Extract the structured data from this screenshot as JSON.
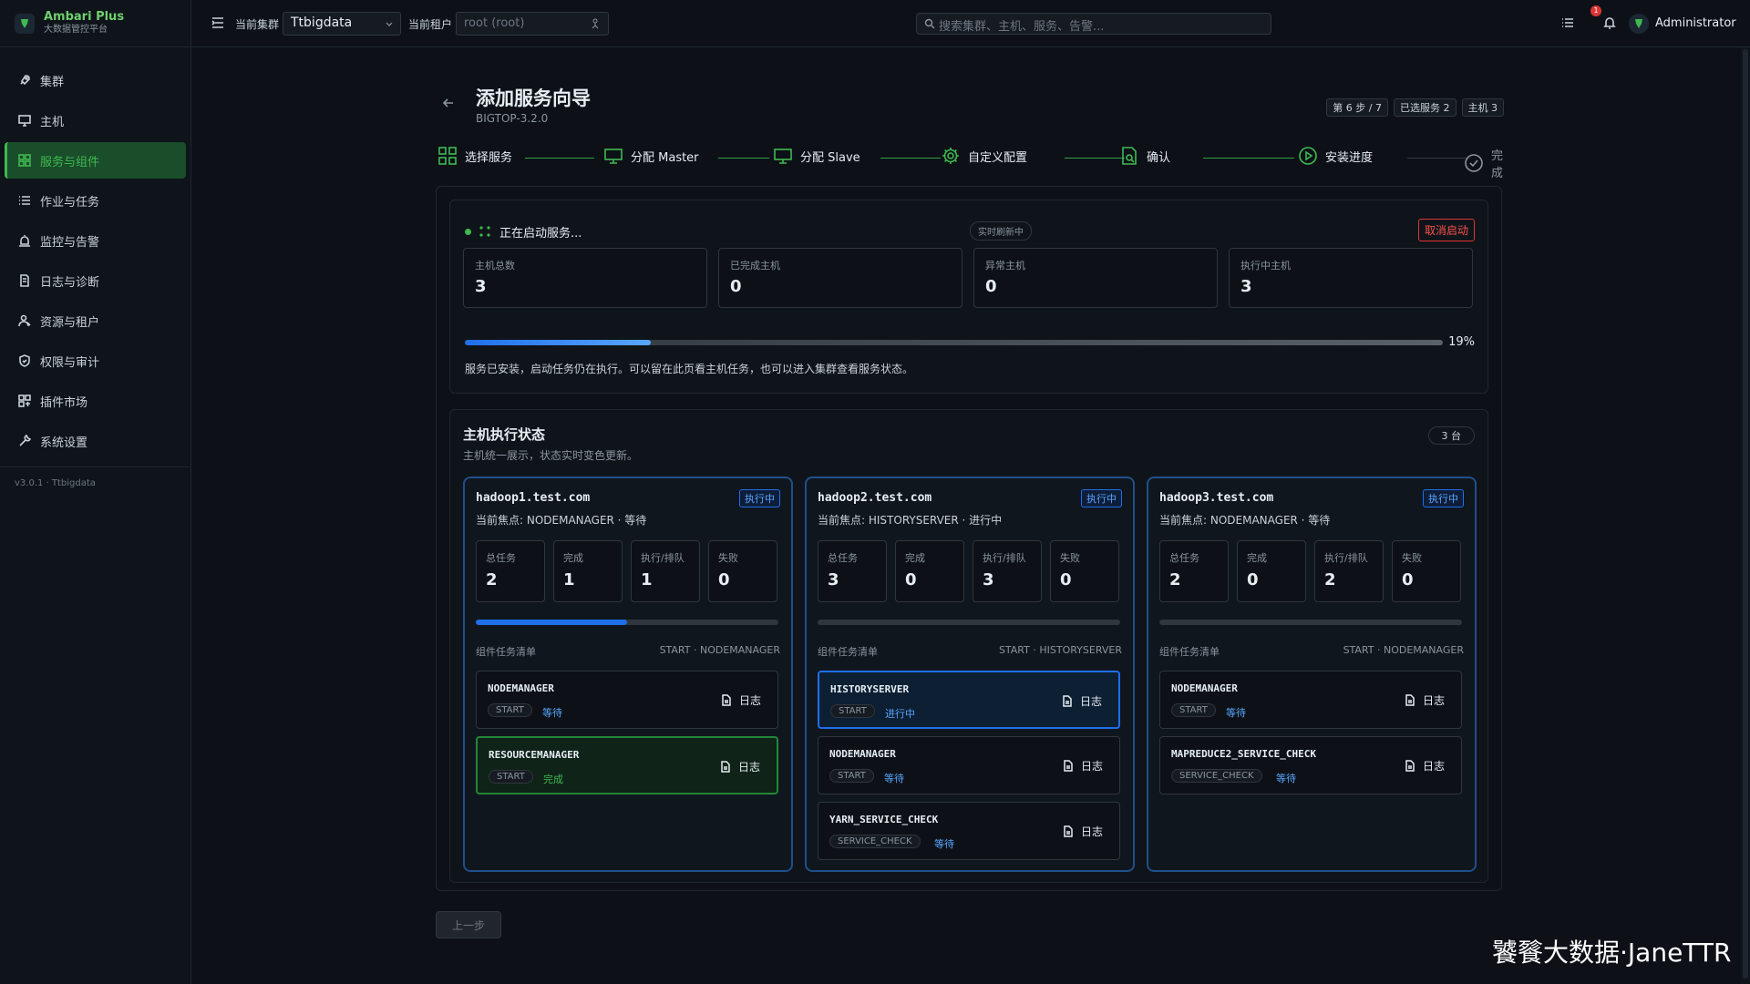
{
  "brand": {
    "title": "Ambari Plus",
    "subtitle": "大数据管控平台"
  },
  "sidebar": {
    "items": [
      {
        "label": "集群",
        "icon": "rocket-icon"
      },
      {
        "label": "主机",
        "icon": "monitor-icon"
      },
      {
        "label": "服务与组件",
        "icon": "grid-icon",
        "active": true
      },
      {
        "label": "作业与任务",
        "icon": "list-icon"
      },
      {
        "label": "监控与告警",
        "icon": "alarm-icon"
      },
      {
        "label": "日志与诊断",
        "icon": "log-icon"
      },
      {
        "label": "资源与租户",
        "icon": "users-icon"
      },
      {
        "label": "权限与审计",
        "icon": "shield-icon"
      },
      {
        "label": "插件市场",
        "icon": "plugin-icon"
      },
      {
        "label": "系统设置",
        "icon": "wrench-icon"
      }
    ],
    "version": "v3.0.1 · Ttbigdata"
  },
  "header": {
    "cluster_label": "当前集群",
    "cluster_value": "Ttbigdata",
    "tenant_label": "当前租户",
    "tenant_placeholder": "root (root)",
    "search_placeholder": "搜索集群、主机、服务、告警...",
    "notification_count": "1",
    "user_name": "Administrator"
  },
  "page": {
    "title": "添加服务向导",
    "subtitle": "BIGTOP-3.2.0",
    "tags": [
      "第 6 步 / 7",
      "已选服务 2",
      "主机 3"
    ]
  },
  "steps": [
    {
      "label": "选择服务",
      "icon": "grid-icon",
      "done": true
    },
    {
      "label": "分配 Master",
      "icon": "monitor-icon",
      "done": true
    },
    {
      "label": "分配 Slave",
      "icon": "monitor-icon",
      "done": true
    },
    {
      "label": "自定义配置",
      "icon": "gear-icon",
      "done": true
    },
    {
      "label": "确认",
      "icon": "document-search-icon",
      "done": true
    },
    {
      "label": "安装进度",
      "icon": "play-circle-icon",
      "done": true
    },
    {
      "label": "完成",
      "icon": "check-circle-icon",
      "done": false
    }
  ],
  "status": {
    "text": "正在启动服务...",
    "live_badge": "实时刷新中",
    "cancel_label": "取消启动",
    "stats": [
      {
        "label": "主机总数",
        "value": "3"
      },
      {
        "label": "已完成主机",
        "value": "0"
      },
      {
        "label": "异常主机",
        "value": "0"
      },
      {
        "label": "执行中主机",
        "value": "3"
      }
    ],
    "progress": 0.19,
    "progress_label": "19%",
    "note": "服务已安装，启动任务仍在执行。可以留在此页看主机任务，也可以进入集群查看服务状态。"
  },
  "hosts_section": {
    "title": "主机执行状态",
    "subtitle": "主机统一展示，状态实时变色更新。",
    "count": "3 台",
    "list_label": "组件任务清单",
    "log_label": "日志",
    "stat_labels": [
      "总任务",
      "完成",
      "执行/排队",
      "失败"
    ]
  },
  "hosts": [
    {
      "name": "hadoop1.test.com",
      "badge": "执行中",
      "focus": "当前焦点:  NODEMANAGER · 等待",
      "stats": [
        "2",
        "1",
        "1",
        "0"
      ],
      "progress": 0.5,
      "meta": "START · NODEMANAGER",
      "tasks": [
        {
          "name": "NODEMANAGER",
          "cmd": "START",
          "state": "等待",
          "kind": "wait"
        },
        {
          "name": "RESOURCEMANAGER",
          "cmd": "START",
          "state": "完成",
          "kind": "done"
        }
      ]
    },
    {
      "name": "hadoop2.test.com",
      "badge": "执行中",
      "focus": "当前焦点:  HISTORYSERVER · 进行中",
      "stats": [
        "3",
        "0",
        "3",
        "0"
      ],
      "progress": 0,
      "meta": "START · HISTORYSERVER",
      "tasks": [
        {
          "name": "HISTORYSERVER",
          "cmd": "START",
          "state": "进行中",
          "kind": "run"
        },
        {
          "name": "NODEMANAGER",
          "cmd": "START",
          "state": "等待",
          "kind": "wait"
        },
        {
          "name": "YARN_SERVICE_CHECK",
          "cmd": "SERVICE_CHECK",
          "state": "等待",
          "kind": "wait"
        }
      ]
    },
    {
      "name": "hadoop3.test.com",
      "badge": "执行中",
      "focus": "当前焦点:  NODEMANAGER · 等待",
      "stats": [
        "2",
        "0",
        "2",
        "0"
      ],
      "progress": 0,
      "meta": "START · NODEMANAGER",
      "tasks": [
        {
          "name": "NODEMANAGER",
          "cmd": "START",
          "state": "等待",
          "kind": "wait"
        },
        {
          "name": "MAPREDUCE2_SERVICE_CHECK",
          "cmd": "SERVICE_CHECK",
          "state": "等待",
          "kind": "wait"
        }
      ]
    }
  ],
  "footer": {
    "prev_label": "上一步"
  },
  "watermark": "饕餮大数据·JaneTTR",
  "colors": {
    "accent": "#3fb950",
    "primary": "#1f6feb",
    "danger": "#f85149",
    "background": "#0d1117"
  }
}
